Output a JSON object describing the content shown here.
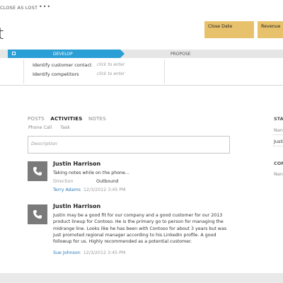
{
  "command_bar": {
    "close_as_lost": "CLOSE AS LOST",
    "more": "•••"
  },
  "record": {
    "title_fragment": "t"
  },
  "kpis": [
    {
      "label": "Close Date"
    },
    {
      "label": "Revenue"
    }
  ],
  "process": {
    "stages": [
      {
        "label": "DEVELOP",
        "active": true
      },
      {
        "label": "PROPOSE",
        "active": false
      }
    ],
    "steps": [
      {
        "label": "Identify customer contact",
        "placeholder": "click to enter"
      },
      {
        "label": "Identify competitors",
        "placeholder": "click to enter"
      }
    ]
  },
  "activity_wall": {
    "tabs": [
      "POSTS",
      "ACTIVITIES",
      "NOTES"
    ],
    "active_tab": "ACTIVITIES",
    "subtabs": [
      "Phone Call",
      "Task"
    ],
    "description_placeholder": "Description",
    "activities": [
      {
        "author": "Justin Harrison",
        "text": "Taking notes while on the phone...",
        "direction_label": "Direction",
        "direction_value": "Outbound",
        "user": "Terry Adams",
        "datetime": "12/3/2012 3:45 PM"
      },
      {
        "author": "Justin Harrison",
        "text_lines": [
          "Justin may be a good fit for our company and a good customer for our 2013",
          "product lineup for Contoso. He is the primary go to person for managing the",
          "midrange line. Looks like he has been with Contoso for about 3 years but was",
          "just promoted regional manager according to his LinkedIn profile. A good",
          "followup for us. Highly recommended as a potential customer."
        ],
        "user": "Sue Johnson",
        "datetime": "12/3/2012 3:45 PM"
      }
    ]
  },
  "right_panel": {
    "section1_title": "STA",
    "name_label": "Nan",
    "name_value": "Justi",
    "section2_title": "COM",
    "name_label2": "Nan"
  },
  "colors": {
    "accent": "#2a9fd6",
    "kpi_tile": "#e8c16c",
    "link": "#2a7ab8",
    "phone_tile": "#7a7a7a"
  }
}
